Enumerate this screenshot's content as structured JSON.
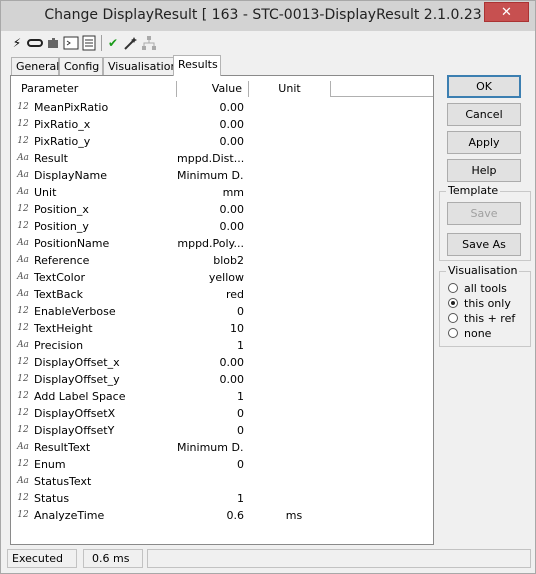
{
  "window": {
    "title": "Change DisplayResult [ 163 - STC-0013-DisplayResult 2.1.0.23 ]",
    "close_label": "✕"
  },
  "toolbar": {
    "icons": [
      "lightning-icon",
      "link-icon",
      "puzzle-icon",
      "console-icon",
      "document-icon",
      "check-icon",
      "wand-icon",
      "network-icon"
    ]
  },
  "tabs": [
    "General",
    "Config",
    "Visualisation",
    "Results"
  ],
  "active_tab": "Results",
  "grid": {
    "headers": {
      "parameter": "Parameter",
      "value": "Value",
      "unit": "Unit"
    },
    "rows": [
      {
        "type": "12",
        "name": "MeanPixRatio",
        "value": "0.00",
        "unit": ""
      },
      {
        "type": "12",
        "name": "PixRatio_x",
        "value": "0.00",
        "unit": ""
      },
      {
        "type": "12",
        "name": "PixRatio_y",
        "value": "0.00",
        "unit": ""
      },
      {
        "type": "Aa",
        "name": "Result",
        "value": "mppd.Dist...",
        "unit": ""
      },
      {
        "type": "Aa",
        "name": "DisplayName",
        "value": "Minimum D...",
        "unit": ""
      },
      {
        "type": "Aa",
        "name": "Unit",
        "value": "mm",
        "unit": ""
      },
      {
        "type": "12",
        "name": "Position_x",
        "value": "0.00",
        "unit": ""
      },
      {
        "type": "12",
        "name": "Position_y",
        "value": "0.00",
        "unit": ""
      },
      {
        "type": "Aa",
        "name": "PositionName",
        "value": "mppd.Poly...",
        "unit": ""
      },
      {
        "type": "Aa",
        "name": "Reference",
        "value": "blob2",
        "unit": ""
      },
      {
        "type": "Aa",
        "name": "TextColor",
        "value": "yellow",
        "unit": ""
      },
      {
        "type": "Aa",
        "name": "TextBack",
        "value": "red",
        "unit": ""
      },
      {
        "type": "12",
        "name": "EnableVerbose",
        "value": "0",
        "unit": ""
      },
      {
        "type": "12",
        "name": "TextHeight",
        "value": "10",
        "unit": ""
      },
      {
        "type": "Aa",
        "name": "Precision",
        "value": "1",
        "unit": ""
      },
      {
        "type": "12",
        "name": "DisplayOffset_x",
        "value": "0.00",
        "unit": ""
      },
      {
        "type": "12",
        "name": "DisplayOffset_y",
        "value": "0.00",
        "unit": ""
      },
      {
        "type": "12",
        "name": "Add Label Space",
        "value": "1",
        "unit": ""
      },
      {
        "type": "12",
        "name": "DisplayOffsetX",
        "value": "0",
        "unit": ""
      },
      {
        "type": "12",
        "name": "DisplayOffsetY",
        "value": "0",
        "unit": ""
      },
      {
        "type": "Aa",
        "name": "ResultText",
        "value": "Minimum D...",
        "unit": ""
      },
      {
        "type": "12",
        "name": "Enum",
        "value": "0",
        "unit": ""
      },
      {
        "type": "Aa",
        "name": "StatusText",
        "value": "",
        "unit": ""
      },
      {
        "type": "12",
        "name": "Status",
        "value": "1",
        "unit": ""
      },
      {
        "type": "12",
        "name": "AnalyzeTime",
        "value": "0.6",
        "unit": "ms"
      }
    ]
  },
  "buttons": {
    "ok": "OK",
    "cancel": "Cancel",
    "apply": "Apply",
    "help": "Help"
  },
  "template": {
    "legend": "Template",
    "save": "Save",
    "save_as": "Save As"
  },
  "visualisation": {
    "legend": "Visualisation",
    "options": [
      "all tools",
      "this only",
      "this + ref",
      "none"
    ],
    "selected": "this only"
  },
  "status": {
    "state": "Executed",
    "time": "0.6 ms"
  }
}
